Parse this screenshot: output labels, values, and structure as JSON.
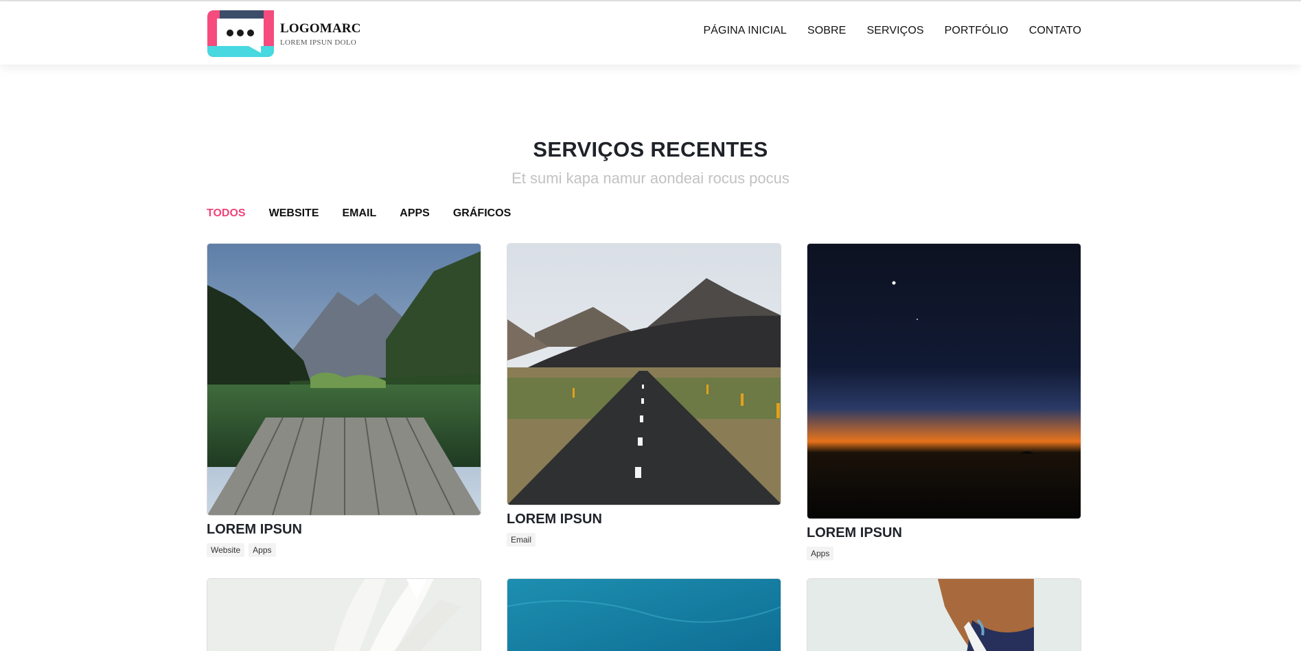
{
  "header": {
    "logo_name": "LOGOMARC",
    "logo_tagline": "LOREM IPSUN DOLO",
    "nav": [
      "PÁGINA INICIAL",
      "SOBRE",
      "SERVIÇOS",
      "PORTFÓLIO",
      "CONTATO"
    ]
  },
  "section": {
    "title": "SERVIÇOS RECENTES",
    "subtitle": "Et sumi kapa namur aondeai rocus pocus"
  },
  "filters": [
    "TODOS",
    "WEBSITE",
    "EMAIL",
    "APPS",
    "GRÁFICOS"
  ],
  "cards": [
    {
      "title": "LOREM IPSUN",
      "tags": [
        "Website",
        "Apps"
      ]
    },
    {
      "title": "LOREM IPSUN",
      "tags": [
        "Email"
      ]
    },
    {
      "title": "LOREM IPSUN",
      "tags": [
        "Apps"
      ]
    }
  ],
  "colors": {
    "accent": "#f0437a",
    "logo_pink": "#f54b7d",
    "logo_cyan": "#47d8e0",
    "logo_navy": "#3c4d6a"
  },
  "icons": [
    "chat-bubble-logo-icon"
  ]
}
